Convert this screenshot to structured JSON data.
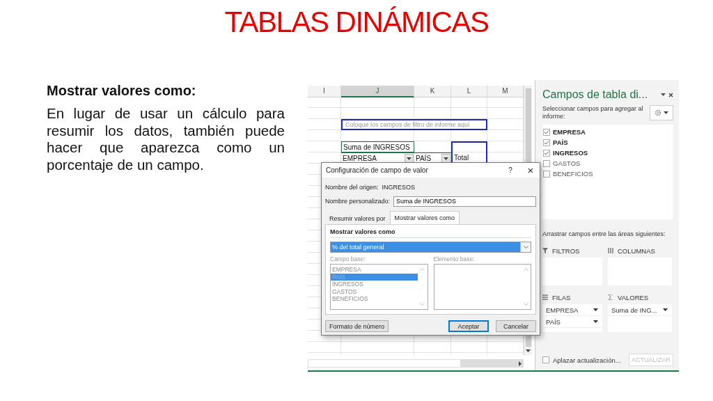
{
  "slide": {
    "title": "TABLAS DINÁMICAS",
    "heading": "Mostrar valores como:",
    "body": "En lugar de usar un cálculo para resumir los datos, también puede hacer que aparezca como un porcentaje de un campo."
  },
  "sheet": {
    "columns": [
      {
        "label": "I",
        "selected": false
      },
      {
        "label": "J",
        "selected": true
      },
      {
        "label": "K",
        "selected": false
      },
      {
        "label": "L",
        "selected": false
      },
      {
        "label": "M",
        "selected": false
      }
    ],
    "filter_placeholder": "Coloque los campos de filtro de informe aquí",
    "value_label": "Suma de INGRESOS",
    "row_headers": [
      {
        "label": "EMPRESA"
      },
      {
        "label": "PAÍS"
      }
    ],
    "total_label": "Total"
  },
  "dialog": {
    "title": "Configuración de campo de valor",
    "help": "?",
    "close": "×",
    "source_label": "Nombre del origen:",
    "source_value": "INGRESOS",
    "custom_name_label": "Nombre personalizado:",
    "custom_name_value": "Suma de INGRESOS",
    "tabs": [
      {
        "label": "Resumir valores por",
        "selected": false
      },
      {
        "label": "Mostrar valores como",
        "selected": true
      }
    ],
    "section_title": "Mostrar valores como",
    "calculation": "% del total general",
    "base_field_label": "Campo base:",
    "base_fields_disabled": true,
    "base_fields": [
      {
        "label": "EMPRESA",
        "selected": false
      },
      {
        "label": "PAÍS",
        "selected": true
      },
      {
        "label": "INGRESOS",
        "selected": false
      },
      {
        "label": "GASTOS",
        "selected": false
      },
      {
        "label": "BENEFICIOS",
        "selected": false
      }
    ],
    "base_item_label": "Elemento base:",
    "buttons": [
      {
        "label": "Formato de número",
        "kind": "plain"
      },
      {
        "label": "Aceptar",
        "kind": "default"
      },
      {
        "label": "Cancelar",
        "kind": "plain"
      }
    ]
  },
  "pane": {
    "title": "Campos de tabla di...",
    "subtitle": "Seleccionar campos para agregar al informe:",
    "fields": [
      {
        "label": "EMPRESA",
        "checked": true
      },
      {
        "label": "PAÍS",
        "checked": true
      },
      {
        "label": "INGRESOS",
        "checked": true
      },
      {
        "label": "GASTOS",
        "checked": false
      },
      {
        "label": "BENEFICIOS",
        "checked": false
      }
    ],
    "areas_hint": "Arrastrar campos entre las áreas siguientes:",
    "areas": [
      {
        "kind": "filters",
        "label": "FILTROS"
      },
      {
        "kind": "columns",
        "label": "COLUMNAS"
      },
      {
        "kind": "rows",
        "label": "FILAS",
        "items": [
          "EMPRESA",
          "PAÍS"
        ]
      },
      {
        "kind": "values",
        "label": "VALORES",
        "items": [
          "Suma de ING..."
        ]
      }
    ],
    "defer": {
      "label": "Aplazar actualización...",
      "checked": false
    },
    "update_button": {
      "label": "ACTUALIZAR",
      "disabled": true
    }
  }
}
